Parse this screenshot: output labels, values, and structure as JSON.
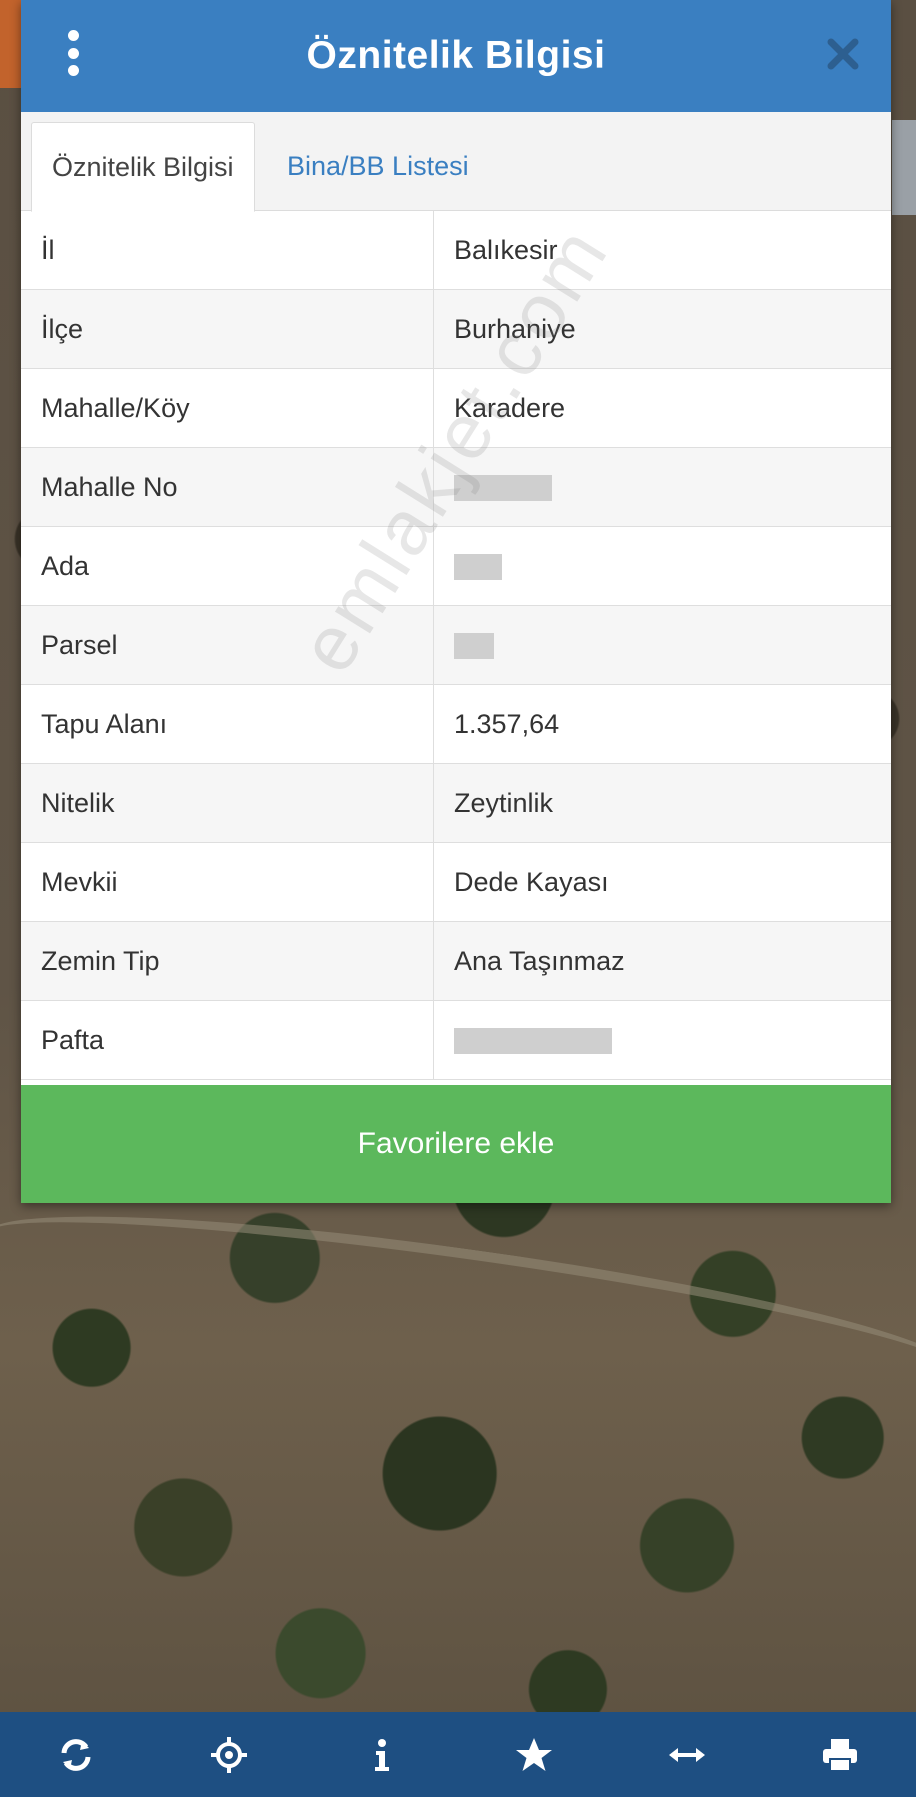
{
  "header": {
    "title": "Öznitelik Bilgisi"
  },
  "tabs": [
    {
      "label": "Öznitelik Bilgisi",
      "active": true
    },
    {
      "label": "Bina/BB Listesi",
      "active": false
    }
  ],
  "attributes": [
    {
      "key": "İl",
      "value": "Balıkesir"
    },
    {
      "key": "İlçe",
      "value": "Burhaniye"
    },
    {
      "key": "Mahalle/Köy",
      "value": "Karadere"
    },
    {
      "key": "Mahalle No",
      "value": null,
      "redacted": true
    },
    {
      "key": "Ada",
      "value": null,
      "redacted": true
    },
    {
      "key": "Parsel",
      "value": null,
      "redacted": true
    },
    {
      "key": "Tapu Alanı",
      "value": "1.357,64"
    },
    {
      "key": "Nitelik",
      "value": "Zeytinlik"
    },
    {
      "key": "Mevkii",
      "value": "Dede Kayası"
    },
    {
      "key": "Zemin Tip",
      "value": "Ana Taşınmaz"
    },
    {
      "key": "Pafta",
      "value": null,
      "redacted": true
    }
  ],
  "actions": {
    "favorite_label": "Favorilere ekle"
  },
  "watermark": "emlakjet.com",
  "toolbar": {
    "icons": [
      "refresh-icon",
      "locate-icon",
      "info-icon",
      "star-icon",
      "measure-icon",
      "print-icon"
    ]
  },
  "colors": {
    "header": "#3a7fc1",
    "favorite_button": "#5cb85c",
    "toolbar": "#1e4f82"
  }
}
